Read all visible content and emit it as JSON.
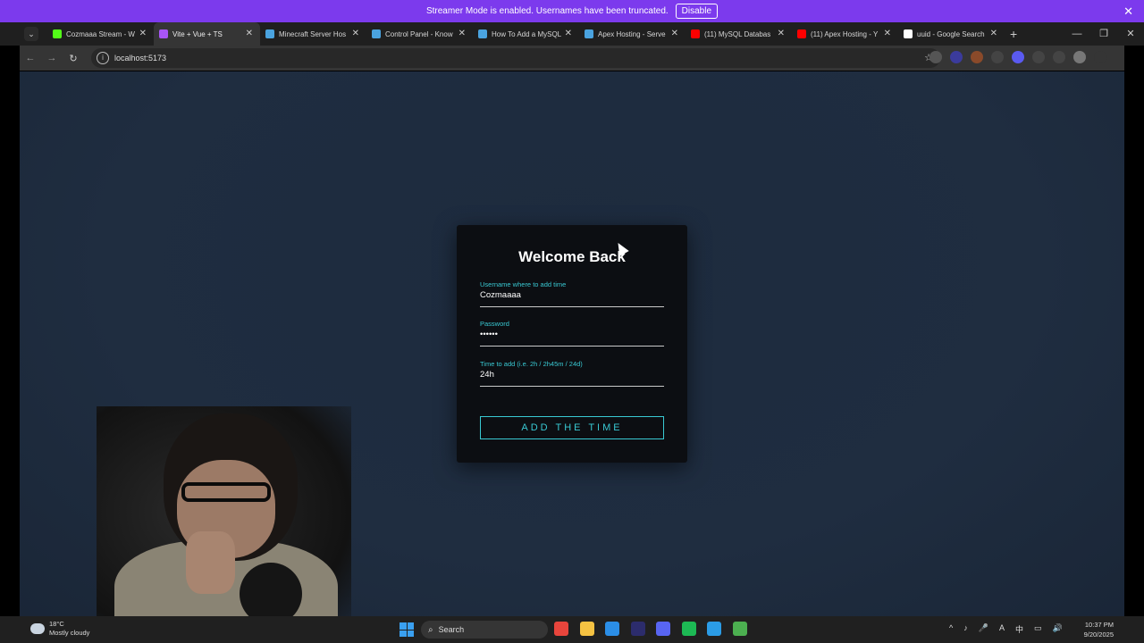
{
  "banner": {
    "message": "Streamer Mode is enabled. Usernames have been truncated.",
    "disable_label": "Disable",
    "close_glyph": "✕"
  },
  "tabs": [
    {
      "title": "Cozmaaa Stream - W",
      "icon": "kick-icon",
      "color": "#53fc18"
    },
    {
      "title": "Vite + Vue + TS",
      "icon": "vite-icon",
      "color": "#a855f7",
      "active": true
    },
    {
      "title": "Minecraft Server Hos",
      "icon": "apex-icon",
      "color": "#4aa3df"
    },
    {
      "title": "Control Panel - Know",
      "icon": "apex-icon",
      "color": "#4aa3df"
    },
    {
      "title": "How To Add a MySQL",
      "icon": "apex-icon",
      "color": "#4aa3df"
    },
    {
      "title": "Apex Hosting - Serve",
      "icon": "apex-icon",
      "color": "#4aa3df"
    },
    {
      "title": "(11) MySQL Databas",
      "icon": "youtube-icon",
      "color": "#ff0000"
    },
    {
      "title": "(11) Apex Hosting - Y",
      "icon": "youtube-icon",
      "color": "#ff0000"
    },
    {
      "title": "uuid - Google Search",
      "icon": "google-icon",
      "color": "#ffffff"
    }
  ],
  "tab_close_glyph": "✕",
  "new_tab_glyph": "+",
  "window_controls": {
    "minimize": "—",
    "restore": "❐",
    "close": "✕"
  },
  "toolbar": {
    "back": "←",
    "forward": "→",
    "reload": "↻",
    "url": "localhost:5173",
    "info_glyph": "i",
    "star_glyph": "☆"
  },
  "extensions": [
    {
      "icon": "extension-icon",
      "color": "#555"
    },
    {
      "icon": "eye-extension-icon",
      "color": "#3b3b9c"
    },
    {
      "icon": "extension-icon",
      "color": "#8a4a2a"
    },
    {
      "icon": "extension-icon",
      "color": "#444"
    },
    {
      "icon": "extension-icon",
      "color": "#5a5af0"
    },
    {
      "icon": "puzzle-icon",
      "color": "#444"
    },
    {
      "icon": "reading-list-icon",
      "color": "#444"
    },
    {
      "icon": "profile-avatar-icon",
      "color": "#777"
    },
    {
      "icon": "kebab-menu-icon",
      "color": "#353535"
    }
  ],
  "form": {
    "title": "Welcome Back",
    "username_label": "Username where to add time",
    "username_value": "Cozmaaaa",
    "password_label": "Password",
    "password_value": "••••••",
    "time_label": "Time to add (i.e. 2h / 2h45m / 24d)",
    "time_value": "24h",
    "submit_label": "ADD THE TIME"
  },
  "colors": {
    "accent": "#39c9d3",
    "banner": "#7c3aed",
    "card": "#0c0e12",
    "page_bg": "#1f2d40"
  },
  "taskbar": {
    "weather_temp": "18°C",
    "weather_desc": "Mostly cloudy",
    "search_placeholder": "Search",
    "apps": [
      {
        "icon": "chrome-icon",
        "color": "#e8453c"
      },
      {
        "icon": "file-explorer-icon",
        "color": "#f5c242"
      },
      {
        "icon": "vscode-icon",
        "color": "#2b8ee6"
      },
      {
        "icon": "app-icon",
        "color": "#2c2c6c"
      },
      {
        "icon": "discord-icon",
        "color": "#5865f2"
      },
      {
        "icon": "spotify-icon",
        "color": "#1db954"
      },
      {
        "icon": "app-icon",
        "color": "#2b9ce6"
      },
      {
        "icon": "minecraft-icon",
        "color": "#4caf50"
      }
    ],
    "tray": [
      "^",
      "♪",
      "🎤",
      "A",
      "中",
      "▭",
      "🔊"
    ],
    "time": "10:37 PM",
    "date": "9/20/2025"
  }
}
